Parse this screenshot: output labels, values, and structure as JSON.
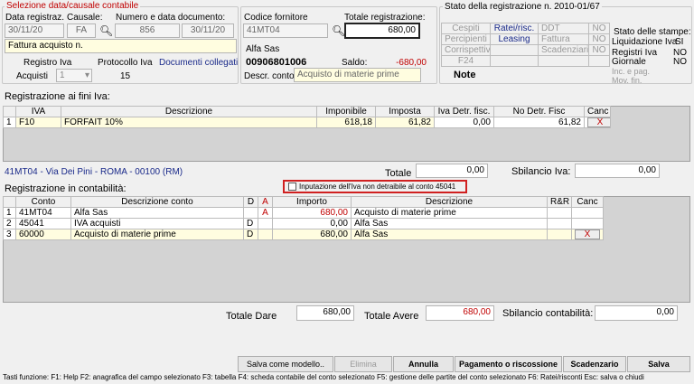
{
  "selection": {
    "legend": "Selezione data/causale contabile",
    "data_label": "Data registraz.",
    "data_value": "30/11/20",
    "causale_label": "Causale:",
    "causale_value": "FA",
    "numero_label": "Numero e data documento:",
    "numero_value": "856",
    "data_doc": "30/11/20",
    "descrizione": "Fattura acquisto n.",
    "registro_label": "Registro Iva",
    "registro_value": "Acquisti",
    "registro_num": "1",
    "protocollo_label": "Protocollo Iva",
    "protocollo_value": "15",
    "documenti_link": "Documenti collegati"
  },
  "fornitore": {
    "codice_label": "Codice fornitore",
    "codice_value": "41MT04",
    "totale_label": "Totale registrazione:",
    "totale_value": "680,00",
    "ragione": "Alfa Sas",
    "piva": "00906801006",
    "saldo_label": "Saldo:",
    "saldo_value": "-680,00",
    "descr_conto_label": "Descr. conto",
    "descr_conto_value": "Acquisto di materie prime"
  },
  "stato": {
    "title": "Stato della registrazione n. 2010-01/67",
    "rows": [
      [
        "Cespiti",
        "Ratei/risc.",
        "DDT",
        "NO"
      ],
      [
        "Percipienti",
        "Leasing",
        "Fattura",
        "NO"
      ],
      [
        "Corrispettivi",
        "",
        "Scadenziario",
        "NO"
      ],
      [
        "F24",
        "",
        "",
        ""
      ]
    ],
    "note": "Note",
    "stampe_title": "Stato delle stampe:",
    "stampe": [
      [
        "Liquidazione Iva",
        "SI"
      ],
      [
        "Registri Iva",
        "NO"
      ],
      [
        "Giornale",
        "NO"
      ],
      [
        "Inc. e pag. Mov. fin.",
        ""
      ]
    ]
  },
  "iva": {
    "title": "Registrazione ai fini Iva:",
    "headers": [
      "IVA",
      "Descrizione",
      "Imponibile",
      "Imposta",
      "Iva Detr. fisc.",
      "No Detr. Fisc",
      "Canc"
    ],
    "rows": [
      {
        "n": "1",
        "iva": "F10",
        "descr": "FORFAIT 10%",
        "imponibile": "618,18",
        "imposta": "61,82",
        "detr": "0,00",
        "nodetr": "61,82",
        "canc": "X"
      }
    ],
    "address": "41MT04 - Via Dei Pini - ROMA - 00100 (RM)",
    "totale_label": "Totale",
    "totale_value": "0,00",
    "sbilancio_label": "Sbilancio Iva:",
    "sbilancio_value": "0,00"
  },
  "contab": {
    "title": "Registrazione in contabilità:",
    "checkbox_label": "Inputazione dell'Iva non detraibile al conto 45041",
    "headers": [
      "Conto",
      "Descrizione conto",
      "D",
      "A",
      "Importo",
      "Descrizione",
      "R&R",
      "Canc"
    ],
    "rows": [
      {
        "n": "1",
        "conto": "41MT04",
        "descr": "Alfa Sas",
        "d": "",
        "a": "A",
        "importo": "680,00",
        "descrizione": "Acquisto di materie prime",
        "canc": ""
      },
      {
        "n": "2",
        "conto": "45041",
        "descr": "IVA acquisti",
        "d": "D",
        "a": "",
        "importo": "0,00",
        "descrizione": "Alfa Sas",
        "canc": ""
      },
      {
        "n": "3",
        "conto": "60000",
        "descr": "Acquisto di materie prime",
        "d": "D",
        "a": "",
        "importo": "680,00",
        "descrizione": "Alfa Sas",
        "canc": "X"
      }
    ],
    "dare_label": "Totale Dare",
    "dare_value": "680,00",
    "avere_label": "Totale Avere",
    "avere_value": "680,00",
    "sbil_label": "Sbilancio contabilità:",
    "sbil_value": "0,00"
  },
  "buttons": {
    "salva_modello": "Salva come modello..",
    "elimina": "Elimina",
    "annulla": "Annulla",
    "pagamento": "Pagamento o riscossione",
    "scadenzario": "Scadenzario",
    "salva": "Salva"
  },
  "status_bar": "Tasti funzione: F1: Help F2: anagrafica del campo selezionato  F3: tabella  F4: scheda contabile del conto selezionato  F5: gestione delle partite del conto selezionato  F6: Ratei/risconti  Esc: salva o chiudi"
}
